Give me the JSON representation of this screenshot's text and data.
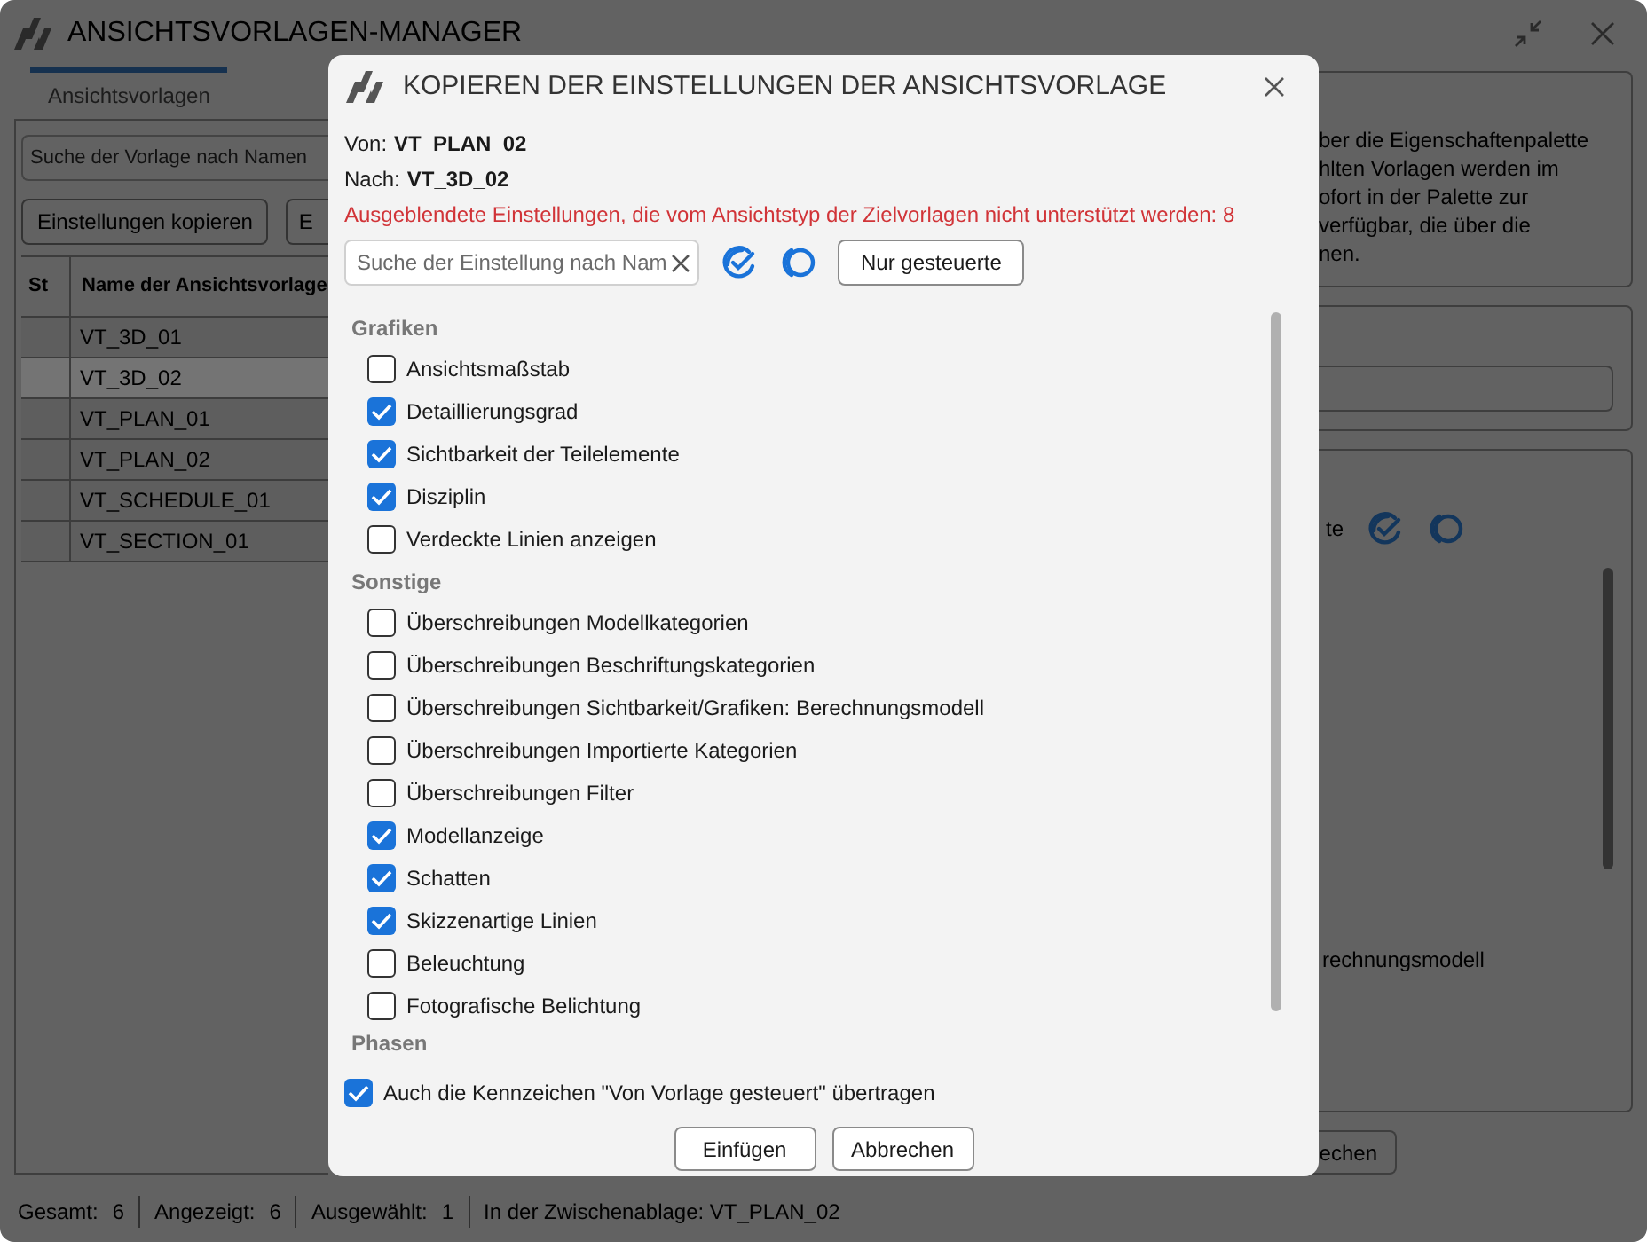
{
  "window": {
    "title": "ANSICHTSVORLAGEN-MANAGER"
  },
  "tabs": [
    {
      "label": "Ansichtsvorlagen",
      "selected": true
    }
  ],
  "search": {
    "placeholder": "Suche der Vorlage nach Namen"
  },
  "toolbar_buttons": [
    "Einstellungen kopieren",
    "E"
  ],
  "table": {
    "columns": [
      "St",
      "Name der Ansichtsvorlage"
    ],
    "rows": [
      {
        "name": "VT_3D_01",
        "selected": false
      },
      {
        "name": "VT_3D_02",
        "selected": true
      },
      {
        "name": "VT_PLAN_01",
        "selected": false
      },
      {
        "name": "VT_PLAN_02",
        "selected": false
      },
      {
        "name": "VT_SCHEDULE_01",
        "selected": false
      },
      {
        "name": "VT_SECTION_01",
        "selected": false
      }
    ]
  },
  "right_panel": {
    "description_lines": [
      "ber die Eigenschaftenpalette",
      "hlten Vorlagen werden im",
      "ofort in der Palette zur",
      "verfügbar, die über die",
      "nen."
    ],
    "label": "te",
    "setting_text": "rechnungsmodell",
    "button": "echen"
  },
  "status_bar": [
    {
      "label": "Gesamt:",
      "value": "6"
    },
    {
      "label": "Angezeigt:",
      "value": "6"
    },
    {
      "label": "Ausgewählt:",
      "value": "1"
    },
    {
      "label": "In der Zwischenablage: VT_PLAN_02"
    }
  ],
  "dialog": {
    "title": "KOPIEREN DER EINSTELLUNGEN DER ANSICHTSVORLAGE",
    "from_label": "Von:",
    "from_value": "VT_PLAN_02",
    "to_label": "Nach:",
    "to_value": "VT_3D_02",
    "warning": "Ausgeblendete Einstellungen, die vom Ansichtstyp der Zielvorlagen nicht unterstützt werden: 8",
    "search": {
      "placeholder": "Suche der Einstellung nach Nam"
    },
    "filter_button": "Nur gesteuerte",
    "groups": [
      {
        "title": "Grafiken",
        "items": [
          {
            "label": "Ansichtsmaßstab",
            "checked": false
          },
          {
            "label": "Detaillierungsgrad",
            "checked": true
          },
          {
            "label": "Sichtbarkeit der Teilelemente",
            "checked": true
          },
          {
            "label": "Disziplin",
            "checked": true
          },
          {
            "label": "Verdeckte Linien anzeigen",
            "checked": false
          }
        ]
      },
      {
        "title": "Sonstige",
        "items": [
          {
            "label": "Überschreibungen Modellkategorien",
            "checked": false
          },
          {
            "label": "Überschreibungen Beschriftungskategorien",
            "checked": false
          },
          {
            "label": "Überschreibungen Sichtbarkeit/Grafiken: Berechnungsmodell",
            "checked": false
          },
          {
            "label": "Überschreibungen Importierte Kategorien",
            "checked": false
          },
          {
            "label": "Überschreibungen Filter",
            "checked": false
          },
          {
            "label": "Modellanzeige",
            "checked": true
          },
          {
            "label": "Schatten",
            "checked": true
          },
          {
            "label": "Skizzenartige Linien",
            "checked": true
          },
          {
            "label": "Beleuchtung",
            "checked": false
          },
          {
            "label": "Fotografische Belichtung",
            "checked": false
          }
        ]
      }
    ],
    "phases_title": "Phasen",
    "transfer_flag": {
      "label": "Auch die Kennzeichen \"Von Vorlage gesteuert\" übertragen",
      "checked": true
    },
    "buttons": [
      "Einfügen",
      "Abbrechen"
    ]
  }
}
